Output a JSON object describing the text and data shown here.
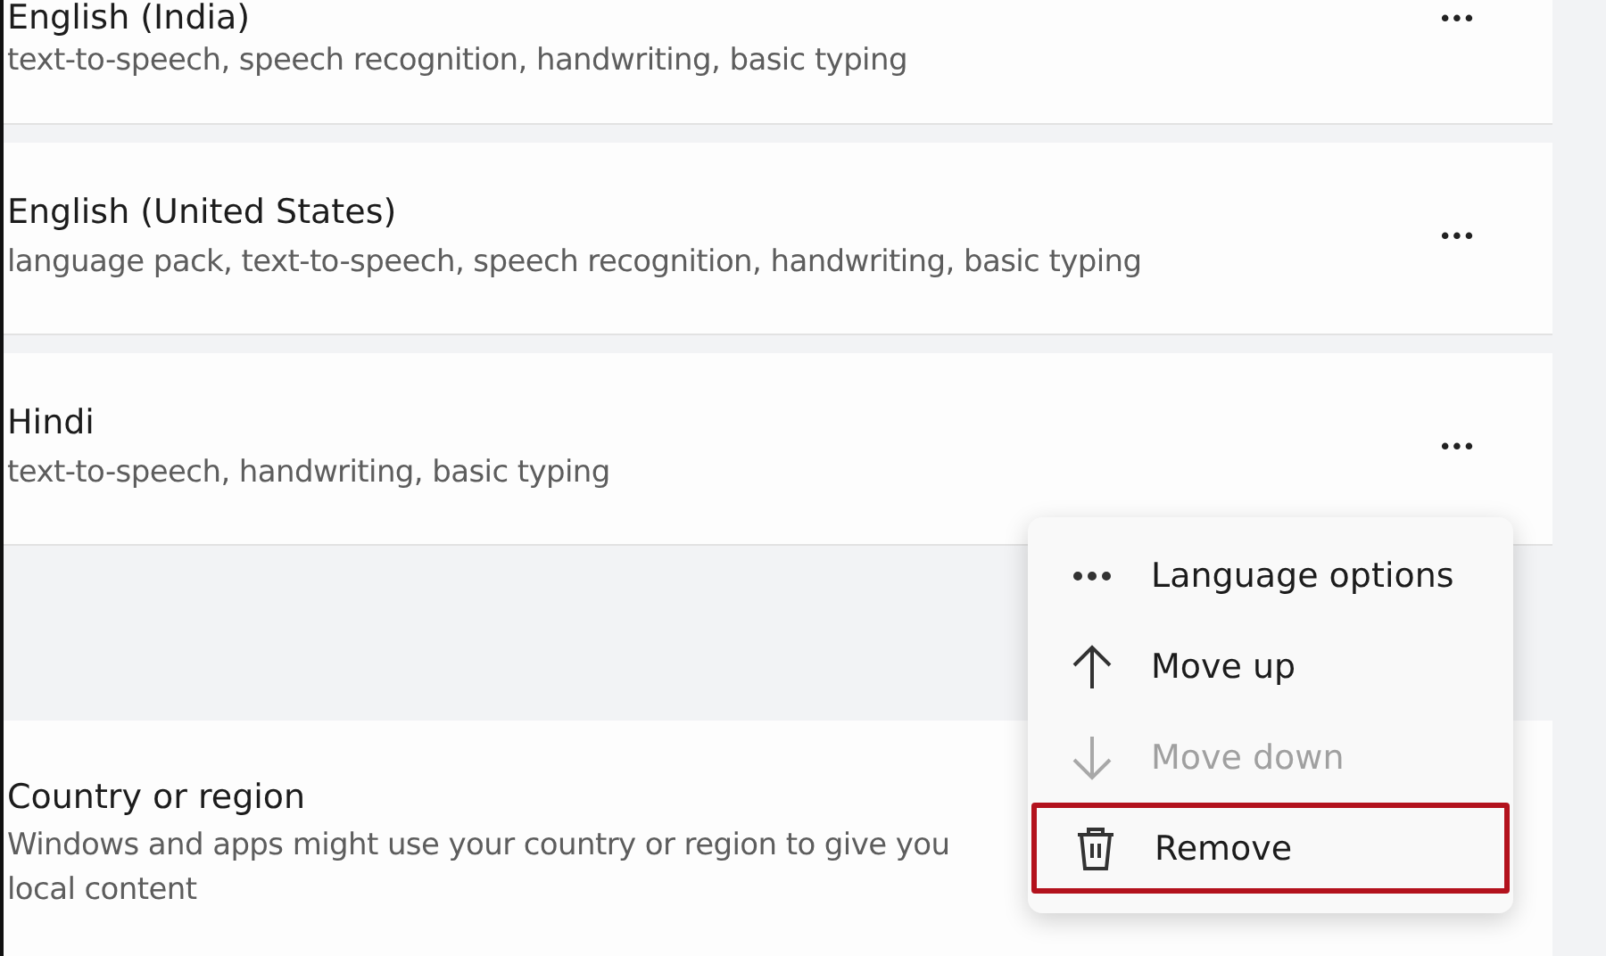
{
  "languages": [
    {
      "name": "English (India)",
      "features": "text-to-speech, speech recognition, handwriting, basic typing"
    },
    {
      "name": "English (United States)",
      "features": "language pack, text-to-speech, speech recognition, handwriting, basic typing"
    },
    {
      "name": "Hindi",
      "features": "text-to-speech, handwriting, basic typing"
    }
  ],
  "more_button": "•••",
  "context_menu": {
    "items": [
      {
        "kind": "more",
        "label": "Language options",
        "disabled": false,
        "highlighted": false
      },
      {
        "kind": "up",
        "label": "Move up",
        "disabled": false,
        "highlighted": false
      },
      {
        "kind": "down",
        "label": "Move down",
        "disabled": true,
        "highlighted": false
      },
      {
        "kind": "remove",
        "label": "Remove",
        "disabled": false,
        "highlighted": true
      }
    ]
  },
  "region": {
    "title": "Country or region",
    "description": "Windows and apps might use your country or region to give you local content"
  }
}
